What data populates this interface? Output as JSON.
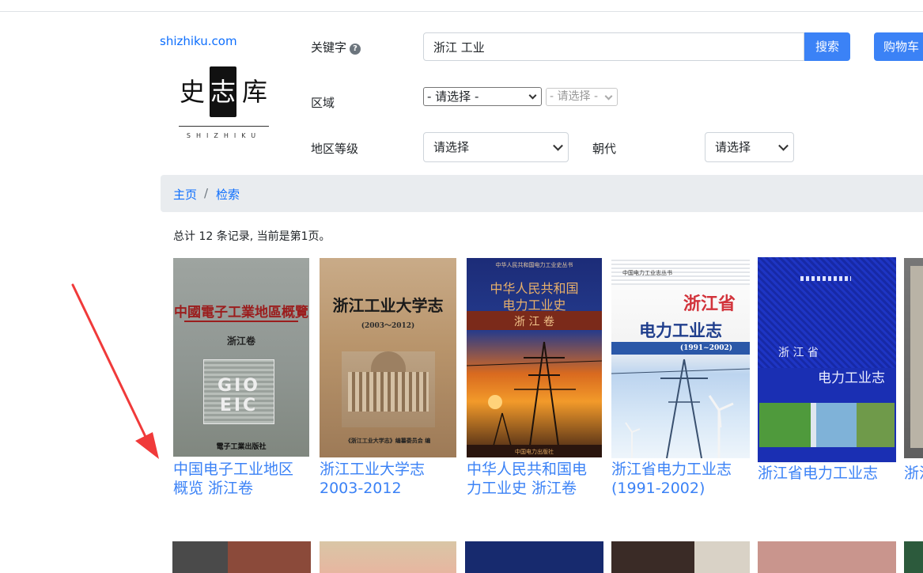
{
  "site": {
    "domain": "shizhiku.com",
    "logo_chars": [
      "史",
      "志",
      "库"
    ],
    "logo_subtitle": "SHIZHIKU"
  },
  "search": {
    "keyword_label": "关键字",
    "keyword_value": "浙江 工业",
    "search_button": "搜索",
    "cart_button": "购物车",
    "region_label": "区域",
    "region_select": "- 请选择 -",
    "region_sub_select": "- 请选择 -",
    "level_label": "地区等级",
    "level_select": "请选择",
    "dynasty_label": "朝代",
    "dynasty_select": "请选择"
  },
  "breadcrumb": {
    "home": "主页",
    "separator": "/",
    "current": "检索"
  },
  "results": {
    "summary": "总计 12 条记录, 当前是第1页。",
    "books": [
      {
        "title": "中国电子工业地区概览 浙江卷",
        "cover_title": "中國電子工業地區概覽",
        "cover_sub": "浙江卷",
        "cover_logo": "GIO EIC",
        "cover_publisher": "電子工業出版社"
      },
      {
        "title": "浙江工业大学志 2003-2012",
        "cover_title": "浙江工业大学志",
        "cover_sub": "(2003～2012)",
        "cover_publisher": "《浙江工业大学志》编纂委员会 编"
      },
      {
        "title": "中华人民共和国电力工业史 浙江卷",
        "cover_series": "中华人民共和国电力工业史丛书",
        "cover_title": "中华人民共和国",
        "cover_title2": "电力工业史",
        "cover_sub": "浙 江 卷",
        "cover_publisher": "中国电力出版社"
      },
      {
        "title": "浙江省电力工业志(1991-2002)",
        "cover_series": "中国电力工业志丛书",
        "cover_title": "浙江省",
        "cover_title2": "电力工业志",
        "cover_sub": "(1991~2002)"
      },
      {
        "title": "浙江省电力工业志",
        "cover_title": "浙 江 省",
        "cover_title2": "电力工业志"
      },
      {
        "title": "浙江...志"
      }
    ]
  },
  "colors": {
    "link": "#3b82f6",
    "primary_button": "#3b82f6",
    "arrow": "#f03a3a"
  }
}
